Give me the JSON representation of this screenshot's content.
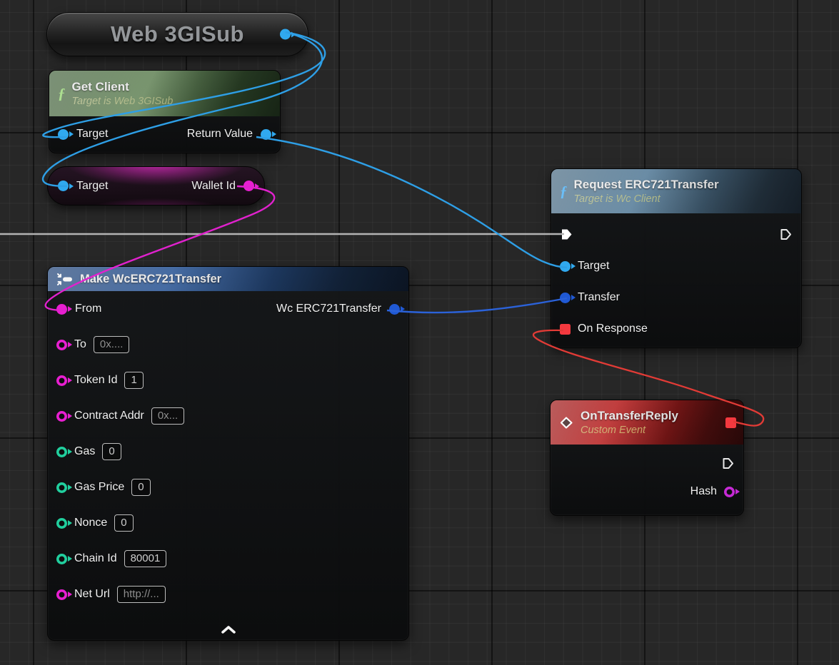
{
  "nodes": {
    "web3gisub": {
      "title": "Web 3GISub"
    },
    "get_client": {
      "title": "Get Client",
      "subtitle": "Target is Web 3GISub",
      "function_glyph": "ƒ",
      "target_label": "Target",
      "return_label": "Return Value"
    },
    "wallet_id": {
      "target_label": "Target",
      "output_label": "Wallet Id"
    },
    "make_transfer": {
      "title": "Make WcERC721Transfer",
      "output_label": "Wc ERC721Transfer",
      "rows": [
        {
          "label": "From"
        },
        {
          "label": "To",
          "value": "0x...."
        },
        {
          "label": "Token Id",
          "value": "1"
        },
        {
          "label": "Contract Addr",
          "value": "0x..."
        },
        {
          "label": "Gas",
          "value": "0"
        },
        {
          "label": "Gas Price",
          "value": "0"
        },
        {
          "label": "Nonce",
          "value": "0"
        },
        {
          "label": "Chain Id",
          "value": "80001"
        },
        {
          "label": "Net Url",
          "value": "http://..."
        }
      ]
    },
    "request_transfer": {
      "title": "Request ERC721Transfer",
      "subtitle": "Target is Wc Client",
      "function_glyph": "ƒ",
      "target_label": "Target",
      "transfer_label": "Transfer",
      "on_response_label": "On Response"
    },
    "on_transfer_reply": {
      "title": "OnTransferReply",
      "subtitle": "Custom Event",
      "hash_label": "Hash"
    }
  },
  "colors": {
    "object_pin": "#30a9ef",
    "struct_pin": "#2059d4",
    "string_pin": "#e81fd1",
    "int_pin": "#21cf9e",
    "delegate_pin": "#f4393f",
    "exec_wire": "#b3b3b3",
    "object_wire": "#2e9fe6",
    "struct_wire": "#2b62d9",
    "string_wire": "#e121ce",
    "delegate_wire": "#e23b36"
  }
}
